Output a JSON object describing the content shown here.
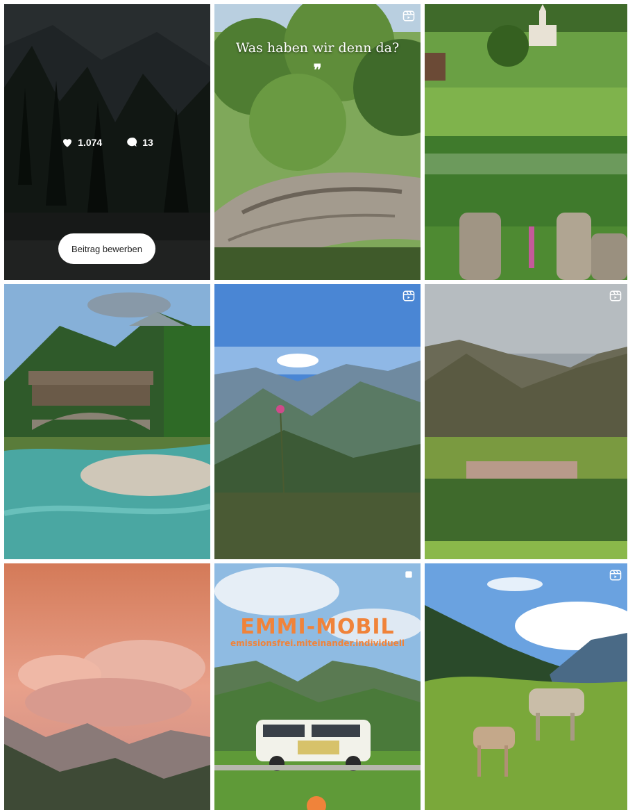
{
  "grid": {
    "tile1": {
      "likes": "1.074",
      "comments": "13",
      "promote_label": "Beitrag bewerben",
      "icons": [
        "heart-icon",
        "comment-icon"
      ]
    },
    "tile2": {
      "caption": "Was haben wir denn da?",
      "quote_mark": "❞",
      "icon": "reel-icon"
    },
    "tile5": {
      "icon": "reel-icon"
    },
    "tile6": {
      "icon": "reel-icon"
    },
    "tile8": {
      "title": "EMMI-MOBIL",
      "subtitle": "emissionsfrei.miteinander.individuell",
      "icon": "multi-post-icon"
    },
    "tile9": {
      "icon": "reel-icon"
    }
  },
  "colors": {
    "accent": "#f0833a",
    "overlay": "rgba(0,0,0,0.45)"
  }
}
